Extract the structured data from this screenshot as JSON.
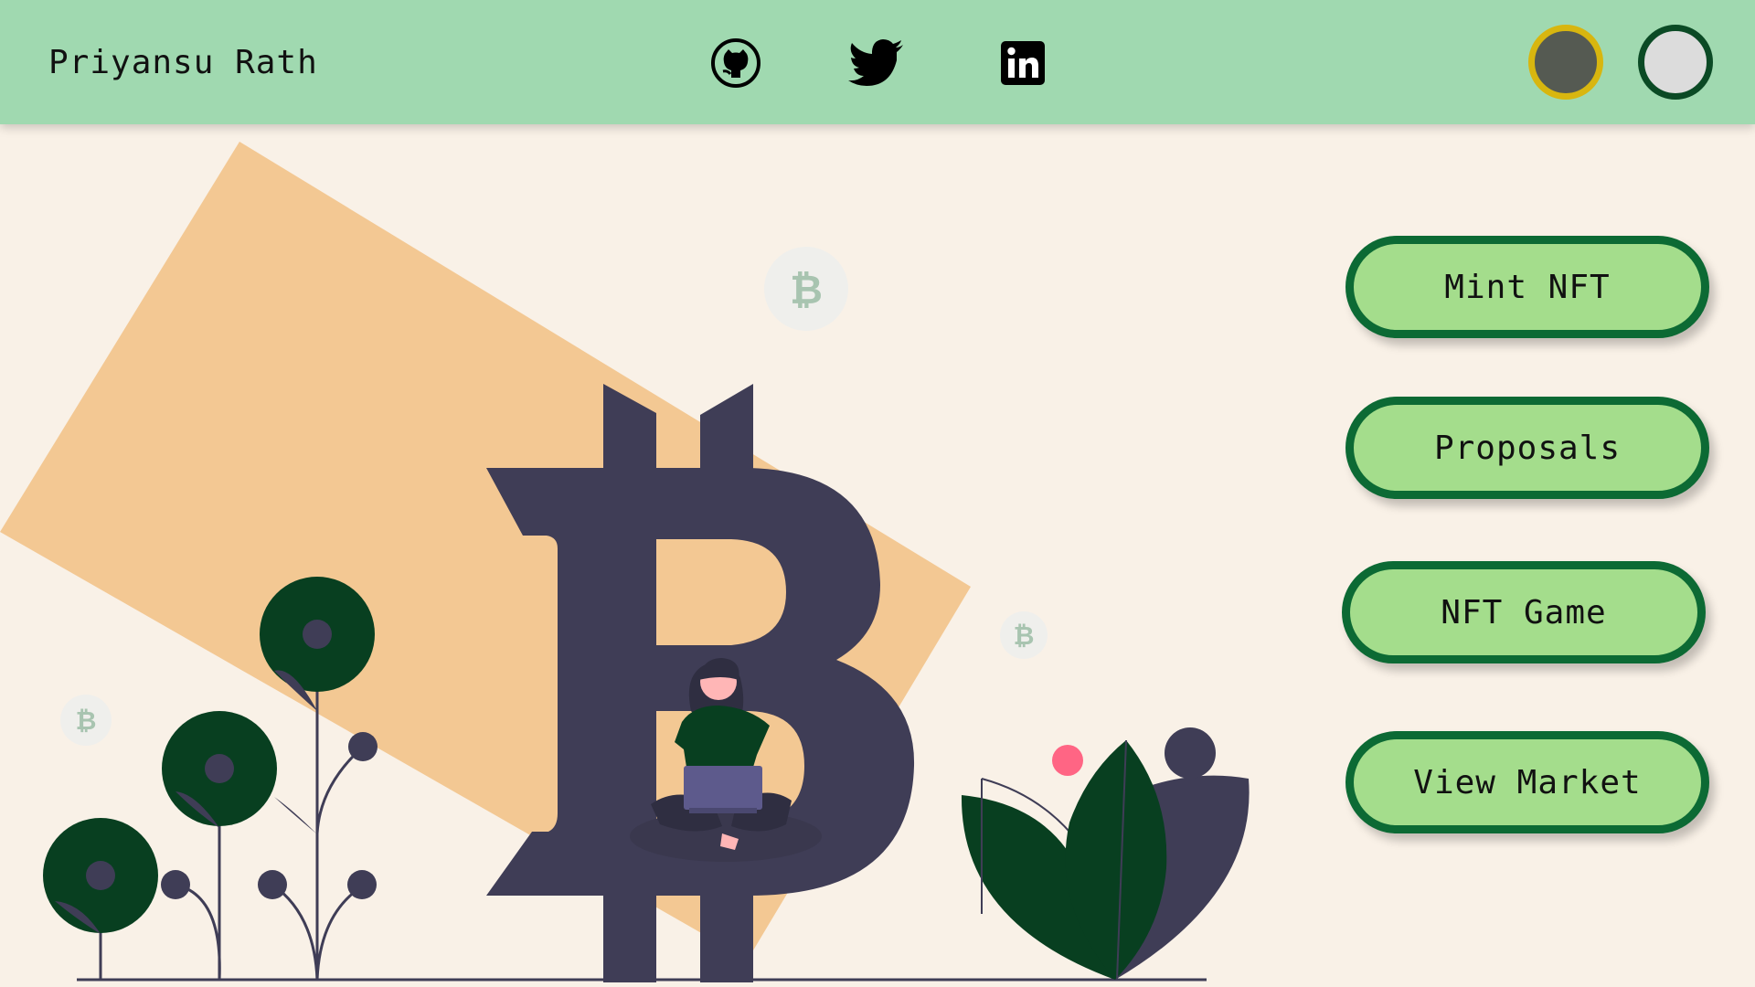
{
  "header": {
    "brand": "Priyansu Rath",
    "social": [
      {
        "name": "github-icon",
        "label": "GitHub"
      },
      {
        "name": "twitter-icon",
        "label": "Twitter"
      },
      {
        "name": "linkedin-icon",
        "label": "LinkedIn"
      }
    ],
    "theme_dots": [
      {
        "name": "dark-theme-toggle",
        "fill": "#555a52",
        "border": "#d8b60f"
      },
      {
        "name": "light-theme-toggle",
        "fill": "#dcdcdc",
        "border": "#0b4a25"
      }
    ]
  },
  "menu": {
    "mint": "Mint NFT",
    "proposals": "Proposals",
    "game": "NFT Game",
    "market": "View Market"
  },
  "illustration": {
    "coin_symbol": "₿"
  },
  "colors": {
    "navbar": "#a0d9b0",
    "page_bg": "#f9f1e7",
    "button_fill": "#a4dd8c",
    "button_border": "#0c6a34",
    "bitcoin_dark": "#3f3d56",
    "peach": "#f3c893",
    "leaf_green": "#083f20"
  }
}
